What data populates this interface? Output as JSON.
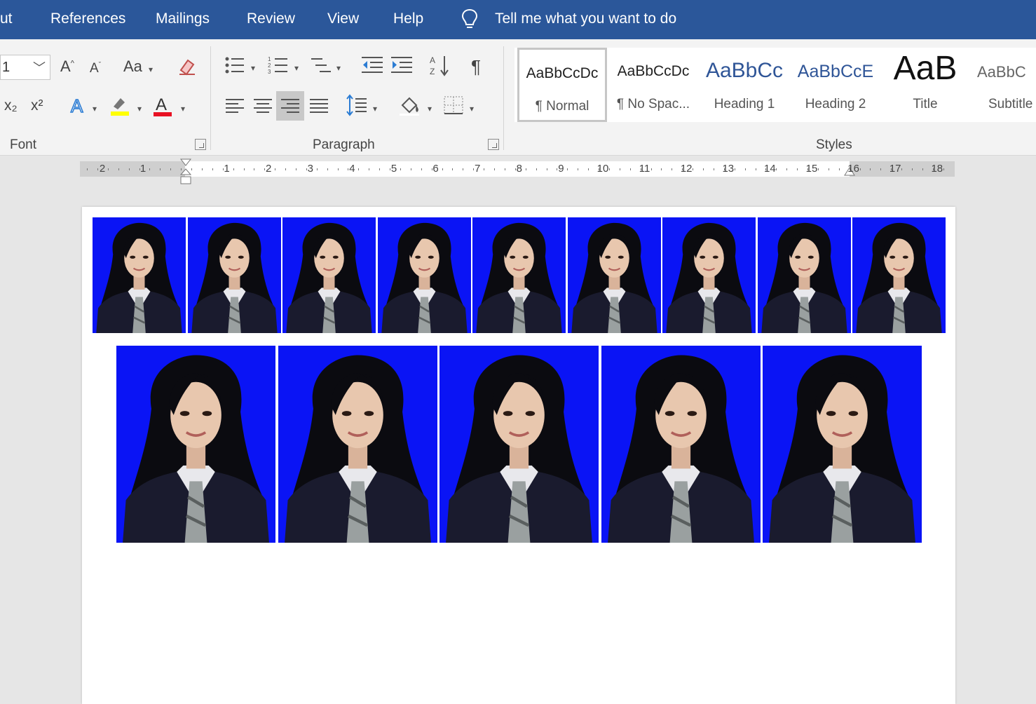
{
  "menu": {
    "tabs": [
      "ut",
      "References",
      "Mailings",
      "Review",
      "View",
      "Help"
    ],
    "tell_me": "Tell me what you want to do",
    "tell_icon": "lightbulb-icon"
  },
  "ribbon": {
    "font_size_value": "1",
    "groups": {
      "font": "Font",
      "paragraph": "Paragraph",
      "styles": "Styles"
    },
    "case_button": "Aa",
    "subscript": "x₂",
    "superscript": "x²"
  },
  "styles": [
    {
      "preview": "AaBbCcDc",
      "name": "¶ Normal"
    },
    {
      "preview": "AaBbCcDc",
      "name": "¶ No Spac..."
    },
    {
      "preview": "AaBbCc",
      "name": "Heading 1"
    },
    {
      "preview": "AaBbCcE",
      "name": "Heading 2"
    },
    {
      "preview": "AaB",
      "name": "Title"
    },
    {
      "preview": "AaBbC",
      "name": "Subtitle"
    }
  ],
  "ruler": {
    "left_numbers": [
      "2",
      "1"
    ],
    "numbers": [
      "1",
      "2",
      "3",
      "4",
      "5",
      "6",
      "7",
      "8",
      "9",
      "10",
      "11",
      "12",
      "13",
      "14",
      "15",
      "16",
      "17",
      "18"
    ]
  },
  "colors": {
    "menubar": "#2b579a",
    "photo_background": "#0a14f5",
    "highlight": "#ffff00",
    "font_color": "#e81123"
  },
  "document": {
    "small_photos_count": 9,
    "large_photos_count": 5
  }
}
